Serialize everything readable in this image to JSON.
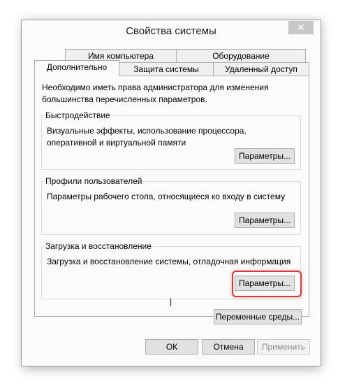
{
  "window": {
    "title": "Свойства системы",
    "close_glyph": "✕"
  },
  "tabs": {
    "row1": [
      "Имя компьютера",
      "Оборудование"
    ],
    "row2": [
      "Дополнительно",
      "Защита системы",
      "Удаленный доступ"
    ],
    "active": "Дополнительно"
  },
  "panel": {
    "note": "Необходимо иметь права администратора для изменения большинства перечисленных параметров.",
    "performance": {
      "title": "Быстродействие",
      "text": "Визуальные эффекты, использование процессора, оперативной и виртуальной памяти",
      "button": "Параметры..."
    },
    "profiles": {
      "title": "Профили пользователей",
      "text": "Параметры рабочего стола, относящиеся ко входу в систему",
      "button": "Параметры..."
    },
    "startup": {
      "title": "Загрузка и восстановление",
      "text": "Загрузка и восстановление системы, отладочная информация",
      "button": "Параметры..."
    },
    "env_button": "Переменные среды..."
  },
  "footer": {
    "ok": "ОК",
    "cancel": "Отмена",
    "apply": "Применить"
  },
  "highlight_color": "#d23b3b"
}
